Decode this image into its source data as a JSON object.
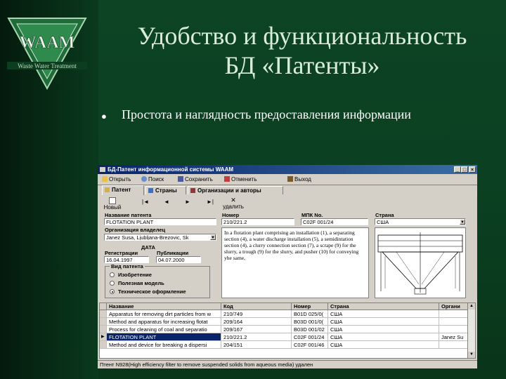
{
  "slide": {
    "title_line1": "Удобство и функциональность",
    "title_line2": "БД «Патенты»",
    "bullet": "Простота и наглядность предоставления информации",
    "logo_text": "WAAM",
    "logo_subtitle": "Waste Water Treatment"
  },
  "window": {
    "title": "БД-Патент информационной системы WAAM",
    "controls": [
      "_",
      "□",
      "×"
    ],
    "toolbar": [
      {
        "label": "Открыть",
        "icon": "open-icon"
      },
      {
        "label": "Поиск",
        "icon": "search-icon"
      },
      {
        "label": "Сохранить",
        "icon": "save-icon"
      },
      {
        "label": "Отменить",
        "icon": "undo-icon"
      },
      {
        "label": "Выход",
        "icon": "exit-icon"
      }
    ],
    "tabs": [
      {
        "label": "Патент",
        "active": true
      },
      {
        "label": "Страны",
        "active": false
      },
      {
        "label": "Организации и авторы",
        "active": false
      }
    ],
    "nav": {
      "new_label": "Новый",
      "delete_label": "удалить",
      "first": "|◄",
      "prev": "◄",
      "next": "►",
      "last": "►|",
      "delete_glyph": "✕"
    },
    "form": {
      "name_label": "Название патента",
      "name_value": "FLOTATION PLANT",
      "number_label": "Номер",
      "number_value": "210/221.2",
      "ipc_label": "МПК No.",
      "ipc_value": "C02F 001/24",
      "country_label": "Страна",
      "country_value": "США",
      "owner_label": "Организация владелец",
      "owner_value": "Janez Susa, Ljubljana-Brezovic, Sk",
      "date_label": "ДАТА",
      "reg_label": "Регистрации",
      "reg_value": "16.04.1997",
      "pub_label": "Публикации",
      "pub_value": "04.07.2000",
      "abstract": "In a flotation plant comprising an installation (1), a separating section (4), a water discharge installation (5), a semidintation section (4), a clurry connection section (7), a scrape (9) for the slurry, a trough (9) for the slurry, and pusher (10) for conveying yhe same,",
      "kind_title": "Вид патента",
      "kinds": [
        {
          "label": "Изобретение",
          "selected": false
        },
        {
          "label": "Полезная модель",
          "selected": false
        },
        {
          "label": "Техническое оформление",
          "selected": true
        }
      ]
    },
    "grid": {
      "columns": [
        "Название",
        "Код",
        "Номер",
        "Страна",
        "Органи"
      ],
      "rows": [
        {
          "name": "Apparatus for removing dirt particles from w",
          "code": "210/749",
          "number": "B01D 025/0(",
          "country": "США",
          "org": "",
          "selected": false
        },
        {
          "name": "Method and apparatus for increasing flotat",
          "code": "209/164",
          "number": "B03D 001/0(",
          "country": "США",
          "org": "",
          "selected": false
        },
        {
          "name": "Process for cleaning of coal and separatio",
          "code": "209/167",
          "number": "B03D 001/02",
          "country": "США",
          "org": "",
          "selected": false
        },
        {
          "name": "FLOTATION PLANT",
          "code": "210/221.2",
          "number": "C02F 001/24",
          "country": "США",
          "org": "Janez Su",
          "selected": true
        },
        {
          "name": "Method and device for breaking a dispersi",
          "code": "204/151",
          "number": "C02F 001/46",
          "country": "США",
          "org": "",
          "selected": false
        }
      ]
    },
    "status": "Птент N928(High efficiency filter to remove suspended solids from aqueous media) удален"
  },
  "colors": {
    "background": "#0b3f21",
    "title_text": "#d9ecd9",
    "selection": "#0a246a",
    "window_face": "#d4d0c8"
  }
}
